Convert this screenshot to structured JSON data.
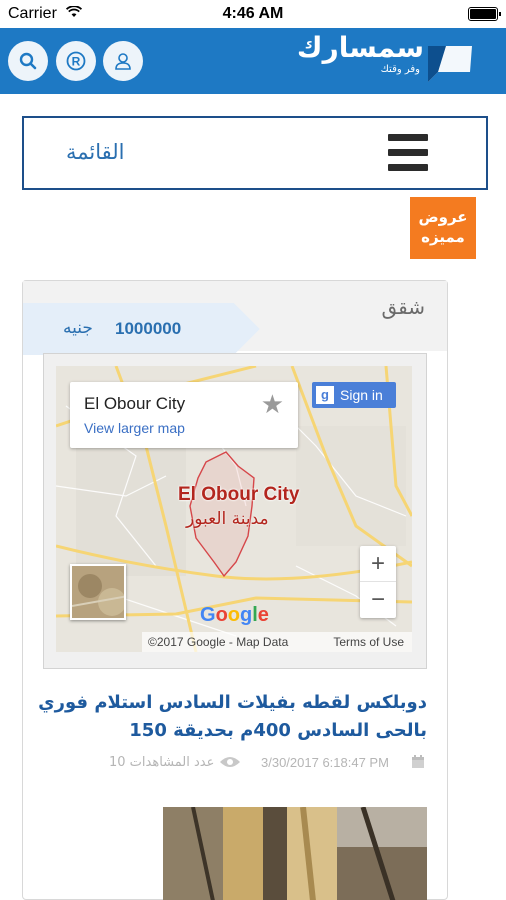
{
  "status_bar": {
    "carrier": "Carrier",
    "time": "4:46 AM"
  },
  "header": {
    "logo_text": "سمسارك",
    "logo_tagline": "وفر وقتك",
    "icons": [
      "search-icon",
      "registered-icon",
      "user-icon"
    ],
    "background": "#1e79c4"
  },
  "menu": {
    "label": "القائمة"
  },
  "featured": {
    "label": "عروض مميزه",
    "color": "#f47b20"
  },
  "listing": {
    "category": "شقق",
    "price_value": "1000000",
    "price_currency": "جنيه",
    "title": "دوبلكس لقطه بفيلات السادس استلام فوري بالحى السادس 400م بحديقة 150",
    "date": "3/30/2017 6:18:47 PM",
    "views": "عدد المشاهدات 10"
  },
  "map": {
    "card_title": "El Obour City",
    "card_link": "View larger map",
    "sign_in": "Sign in",
    "city_en": "El Obour City",
    "city_ar": "مدينة العبور",
    "zoom_in": "+",
    "zoom_out": "−",
    "brand": "Google",
    "copyright": "©2017 Google - Map Data",
    "terms": "Terms of Use"
  }
}
